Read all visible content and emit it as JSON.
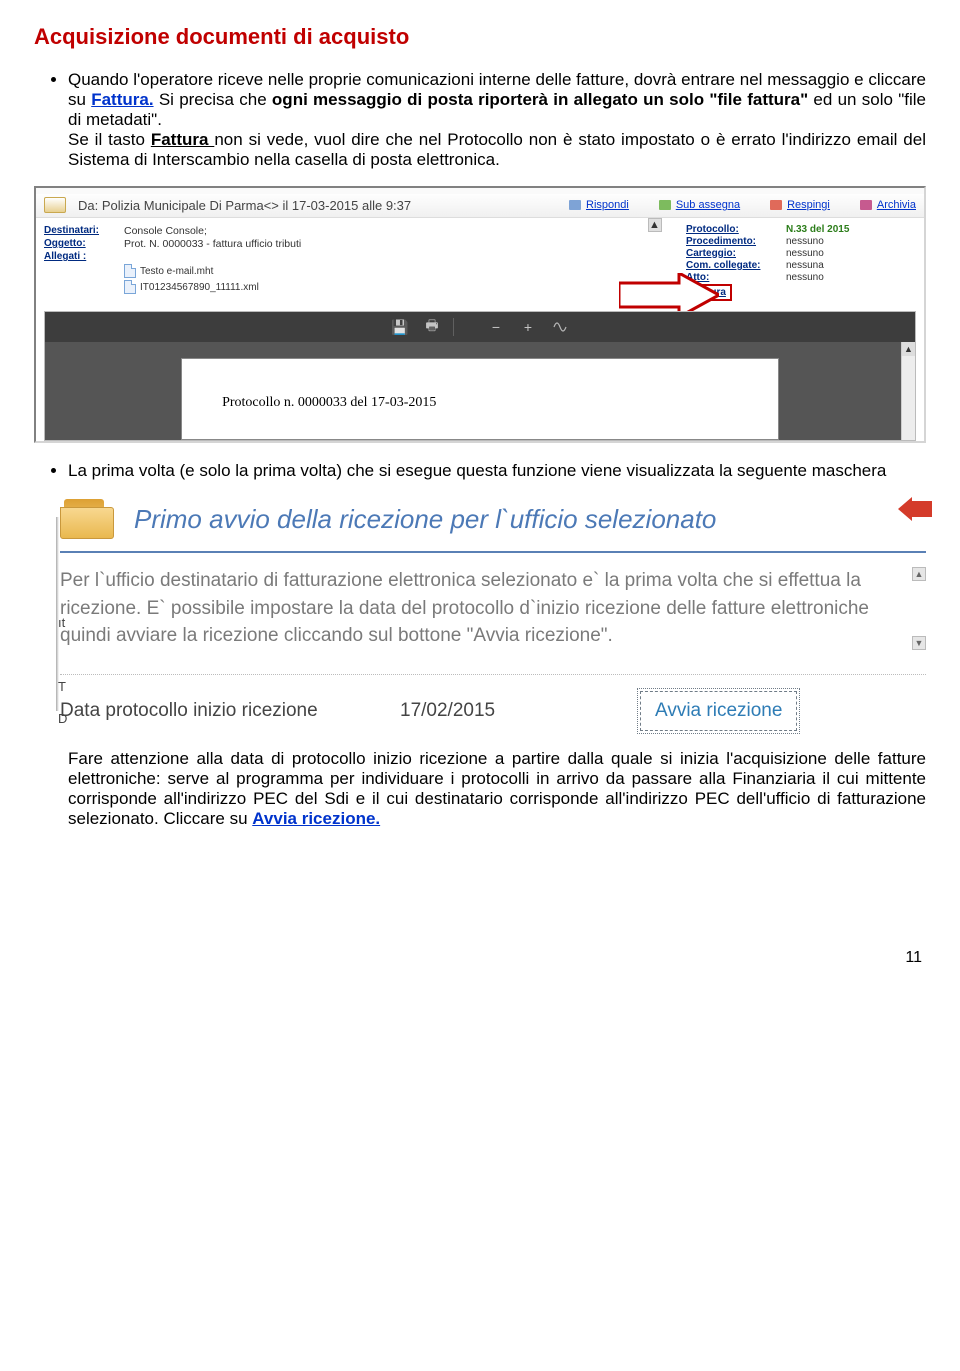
{
  "page": {
    "section_title": "Acquisizione documenti di acquisto",
    "page_number": "11"
  },
  "paragraphs": {
    "p1a": "Quando l'operatore riceve nelle proprie comunicazioni interne delle fatture, dovrà entrare nel messaggio e cliccare su ",
    "p1_link": "Fattura.",
    "p1b": " Si precisa che ",
    "p1_bold1": "ogni messaggio di posta riporterà in allegato un solo \"file fattura\"",
    "p1c": " ed un solo \"file di metadati\".",
    "p1d": "Se il tasto ",
    "p1_bold2": "Fattura ",
    "p1e": " non si vede, vuol dire che nel Protocollo non è stato impostato o è errato l'indirizzo email del Sistema di Interscambio nella casella di posta elettronica.",
    "p2": "La prima volta (e solo la prima volta)  che si esegue questa funzione viene visualizzata la seguente maschera",
    "p3a": "Fare attenzione alla data di protocollo inizio ricezione a partire dalla quale si inizia l'acquisizione delle fatture elettroniche: serve al programma per individuare i protocolli in arrivo da passare alla Finanziaria il cui mittente corrisponde all'indirizzo PEC del Sdi e il cui destinatario corrisponde all'indirizzo PEC dell'ufficio di fatturazione selezionato. Cliccare su ",
    "p3_link": "Avvia ricezione."
  },
  "email": {
    "from": "Da: Polizia Municipale Di Parma<> il 17-03-2015 alle  9:37",
    "actions": {
      "reply": "Rispondi",
      "subassign": "Sub assegna",
      "reject": "Respingi",
      "archive": "Archivia"
    },
    "labels": {
      "destinatari": "Destinatari:",
      "oggetto": "Oggetto:",
      "allegati": "Allegati :"
    },
    "values": {
      "destinatari": "Console Console;",
      "oggetto": "Prot. N. 0000033 - fattura ufficio tributi"
    },
    "attachments": [
      "Testo e-mail.mht",
      "IT01234567890_11111.xml"
    ],
    "right_labels": {
      "protocollo": "Protocollo:",
      "procedimento": "Procedimento:",
      "carteggio": "Carteggio:",
      "collegate": "Com. collegate:",
      "atto": "Atto:",
      "fattura": "Fattura"
    },
    "right_values": {
      "protocollo": "N.33 del 2015",
      "procedimento": "nessuno",
      "carteggio": "nessuno",
      "collegate": "nessuna",
      "atto": "nessuno"
    },
    "pdf_line": "Protocollo n. 0000033 del 17-03-2015"
  },
  "dialog": {
    "title": "Primo avvio della ricezione per l`ufficio selezionato",
    "body": "Per l`ufficio destinatario di fatturazione elettronica selezionato e` la prima volta che si effettua la ricezione. E` possibile impostare la data del protocollo d`inizio ricezione delle fatture elettroniche quindi avviare la ricezione cliccando sul bottone \"Avvia ricezione\".",
    "field_label": "Data protocollo inizio ricezione",
    "date_value": "17/02/2015",
    "button": "Avvia ricezione"
  }
}
